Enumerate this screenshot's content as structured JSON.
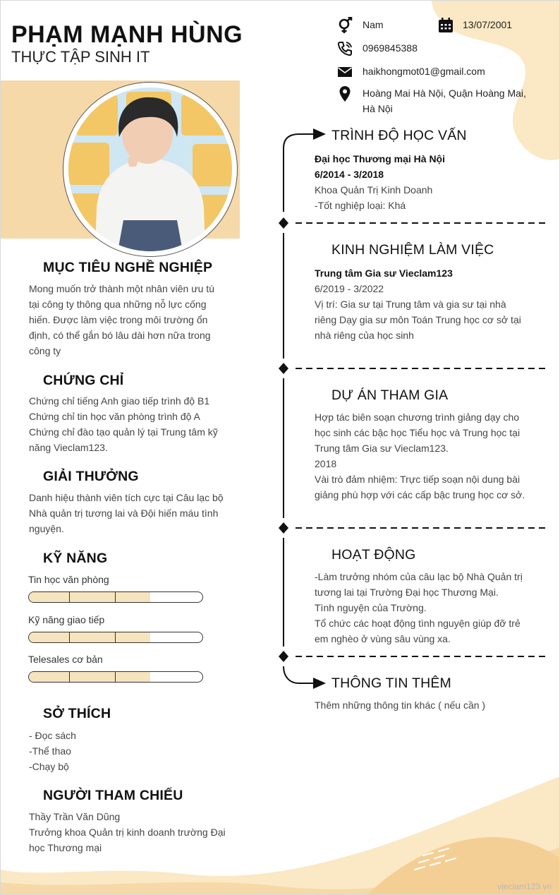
{
  "header": {
    "name": "PHẠM MẠNH HÙNG",
    "role": "THỰC TẬP SINH IT"
  },
  "contact": {
    "gender": "Nam",
    "birthday": "13/07/2001",
    "phone": "0969845388",
    "email": "haikhongmot01@gmail.com",
    "address_lines": [
      "Hoàng Mai Hà Nội, Quận Hoàng Mai,",
      "Hà Nội"
    ]
  },
  "career_goal": {
    "title": "MỤC TIÊU NGHỀ NGHIỆP",
    "lines": [
      "Mong muốn trở thành một nhân viên ưu tú",
      "tại công ty thông qua những nỗ lực cống",
      "hiến. Được làm việc trong môi trường ổn",
      "định, có thể gắn bó lâu dài hơn nữa trong",
      "công ty"
    ]
  },
  "certificates": {
    "title": "CHỨNG CHỈ",
    "lines": [
      "Chứng chỉ tiếng Anh giao tiếp trình độ B1",
      "Chứng chỉ tin học văn phòng trình độ A",
      "Chứng chỉ đào tạo quản lý tại Trung tâm kỹ",
      "năng Vieclam123."
    ]
  },
  "awards": {
    "title": "GIẢI THƯỞNG",
    "lines": [
      "Danh hiệu thành viên tích cực tại Câu lạc bộ",
      "Nhà quản trị tương lai và Đội hiến máu tình",
      "nguyện."
    ]
  },
  "skills": {
    "title": "KỸ NĂNG",
    "items": [
      {
        "label": "Tin học văn phòng",
        "level": 0.7
      },
      {
        "label": "Kỹ năng giao tiếp",
        "level": 0.7
      },
      {
        "label": "Telesales cơ bản",
        "level": 0.7
      }
    ]
  },
  "hobbies": {
    "title": "SỞ THÍCH",
    "lines": [
      "- Đọc sách",
      "-Thể thao",
      "-Chạy bộ"
    ]
  },
  "references": {
    "title": "NGƯỜI THAM CHIẾU",
    "lines": [
      "Thầy Trần Văn Dũng",
      "Trưởng khoa Quản trị kinh doanh trường Đại",
      "học Thương mại"
    ]
  },
  "education": {
    "title": "TRÌNH ĐỘ HỌC VẤN",
    "school": "Đại học Thương mại Hà Nội",
    "period": "6/2014 - 3/2018",
    "faculty": "Khoa Quản Trị Kinh Doanh",
    "grade": "-Tốt nghiệp loại: Khá"
  },
  "experience": {
    "title": "KINH NGHIỆM LÀM VIỆC",
    "company": "Trung tâm Gia sư Vieclam123",
    "period": "6/2019 - 3/2022",
    "lines": [
      "Vị trí: Gia sư tại Trung tâm và gia sư tại nhà",
      "riêng Dạy gia sư môn Toán Trung học cơ sở tại",
      "nhà riêng của học sinh"
    ]
  },
  "projects": {
    "title": "DỰ ÁN THAM GIA",
    "lines": [
      "Hợp tác biên soạn chương trình giảng dạy cho",
      "học sinh các bậc học Tiểu học và Trung học tại",
      "Trung tâm Gia sư Vieclam123.",
      "2018",
      "Vài trò đảm nhiệm: Trực tiếp soạn nội dung bài",
      "giảng phù hợp với các cấp bậc trung học cơ sở."
    ]
  },
  "activities": {
    "title": "HOẠT ĐỘNG",
    "lines": [
      "-Làm trưởng nhóm của câu lạc bộ Nhà Quản trị",
      "tương lai tại Trường Đại học Thương Mại.",
      "Tình nguyện của Trường.",
      "Tổ chức các hoạt động tình nguyện giúp đỡ trẻ",
      "em nghèo ở vùng sâu vùng xa."
    ]
  },
  "extra": {
    "title": "THÔNG TIN THÊM",
    "text": "Thêm những thông tin khác ( nếu cần )"
  },
  "footer": {
    "watermark": "vieclam123.vn"
  },
  "colors": {
    "accent": "#f6d9a8",
    "accent_light": "#fbe8c4",
    "skill_fill": "#f5e4bd",
    "text_dark": "#111111",
    "text_body": "#444444"
  }
}
